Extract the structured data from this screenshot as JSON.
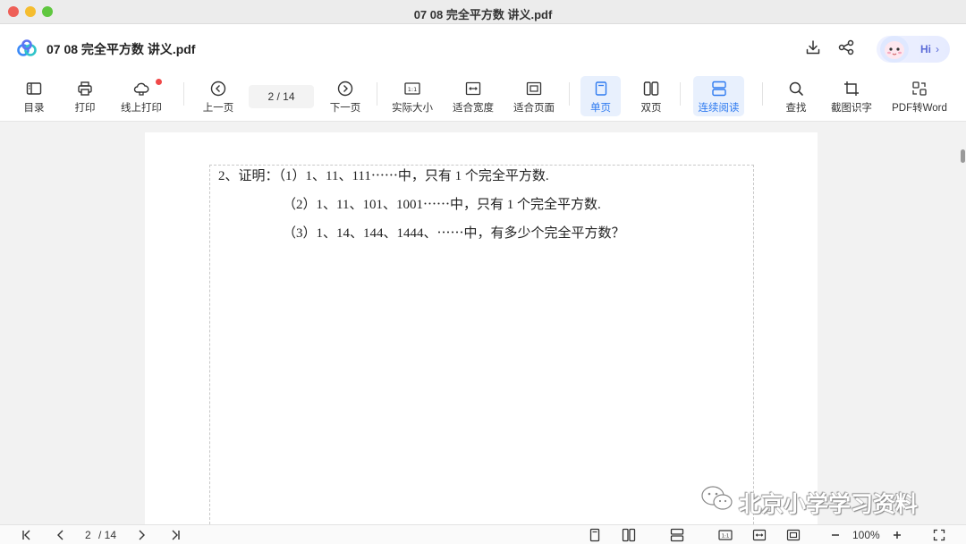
{
  "window": {
    "title": "07 08 完全平方数 讲义.pdf"
  },
  "header": {
    "doc_title": "07 08 完全平方数 讲义.pdf",
    "assistant_label": "Hi"
  },
  "toolbar": {
    "toc": "目录",
    "print": "打印",
    "online_print": "线上打印",
    "prev_page": "上一页",
    "page_indicator": "2  / 14",
    "next_page": "下一页",
    "actual_size": "实际大小",
    "fit_width": "适合宽度",
    "fit_page": "适合页面",
    "single_page": "单页",
    "double_page": "双页",
    "continuous": "连续阅读",
    "find": "查找",
    "ocr": "截图识字",
    "pdf_to_word": "PDF转Word"
  },
  "document": {
    "lines": [
      "2、证明：（1）1、11、111⋯⋯中，只有 1 个完全平方数.",
      "（2）1、11、101、1001⋯⋯中，只有 1 个完全平方数.",
      "（3）1、14、144、1444、⋯⋯中，有多少个完全平方数？"
    ]
  },
  "watermark": {
    "text": "北京小学学习资料"
  },
  "statusbar": {
    "page": "2",
    "total": "/ 14",
    "zoom": "100%"
  },
  "colors": {
    "accent": "#2f7bf0",
    "active_bg": "#e8f0fd",
    "notify": "#f04848"
  },
  "icons": [
    "app-logo-icon",
    "download-icon",
    "share-icon",
    "toc-icon",
    "print-icon",
    "cloud-print-icon",
    "prev-page-icon",
    "next-page-icon",
    "actual-size-icon",
    "fit-width-icon",
    "fit-page-icon",
    "single-page-icon",
    "double-page-icon",
    "continuous-icon",
    "search-icon",
    "ocr-icon",
    "pdf-to-word-icon",
    "first-page-icon",
    "last-page-icon",
    "zoom-out-icon",
    "zoom-in-icon",
    "fullscreen-icon",
    "wechat-icon"
  ]
}
